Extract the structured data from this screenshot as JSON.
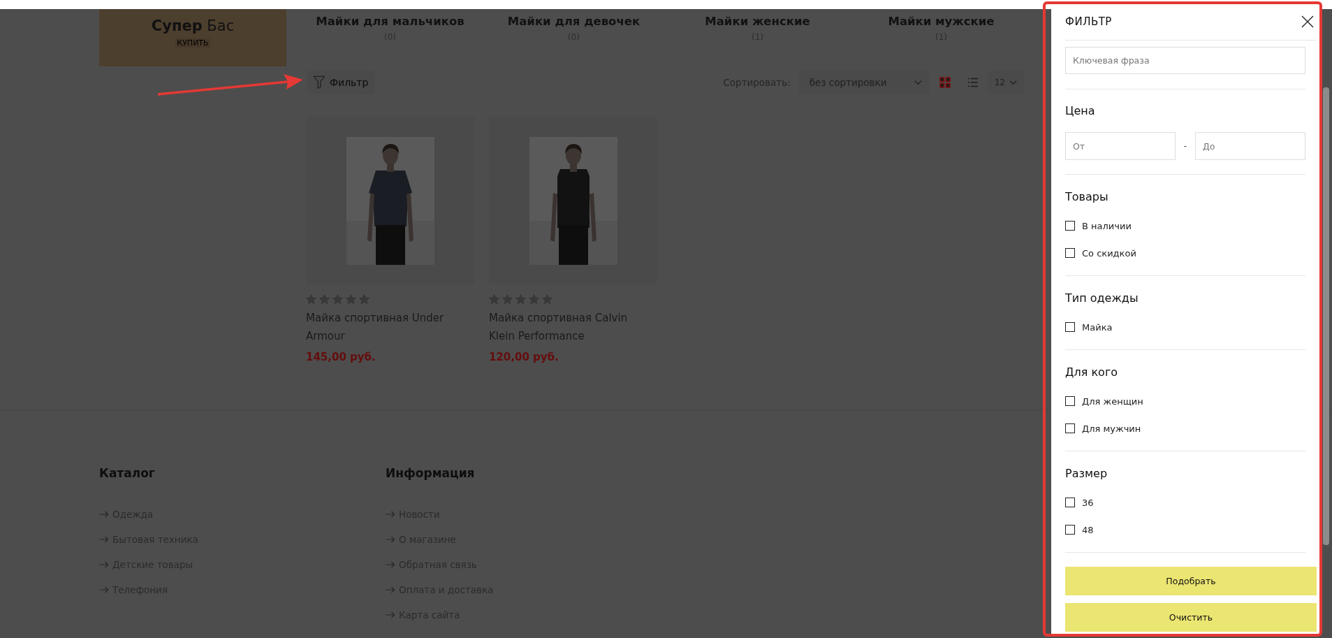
{
  "banner": {
    "title": "**Супер** Бас",
    "link": "КУПИТЬ"
  },
  "categories": [
    {
      "name": "Майки для мальчиков",
      "count": "(0)"
    },
    {
      "name": "Майки для девочек",
      "count": "(0)"
    },
    {
      "name": "Майки женские",
      "count": "(1)"
    },
    {
      "name": "Майки мужские",
      "count": "(1)"
    }
  ],
  "toolbar": {
    "filter_button": "Фильтр",
    "sort_label": "Сортировать:",
    "sort_value": "без сортировки",
    "views": [
      {
        "kind": "grid",
        "selected": true
      },
      {
        "kind": "list",
        "selected": false
      }
    ],
    "per_page": "12"
  },
  "products": [
    {
      "kind": "picture",
      "name": "Майка спортивная Under Armour",
      "price": "145,00 руб.",
      "stars": 0
    },
    {
      "kind": "picture",
      "name": "Майка спортивная Calvin Klein Performance",
      "price": "120,00 руб.",
      "stars": 0
    }
  ],
  "footer": {
    "columns": [
      {
        "title": "Каталог",
        "links": [
          "Одежда",
          "Бытовая техника",
          "Детские товары",
          "Телефония"
        ]
      },
      {
        "title": "Информация",
        "links": [
          "Новости",
          "О магазине",
          "Обратная связь",
          "Оплата и доставка",
          "Карта сайта"
        ]
      }
    ]
  },
  "filter_panel": {
    "title": "ФИЛЬТР",
    "sections": [
      {
        "kind": "search",
        "placeholder": "Ключевая фраза"
      },
      {
        "kind": "range",
        "title": "Цена",
        "from_placeholder": "От",
        "separator": "-",
        "to_placeholder": "До"
      },
      {
        "kind": "checks",
        "title": "Товары",
        "options": [
          {
            "label": "В наличии",
            "checked": false
          },
          {
            "label": "Со скидкой",
            "checked": false
          }
        ]
      },
      {
        "kind": "checks",
        "title": "Тип одежды",
        "options": [
          {
            "label": "Майка",
            "checked": false
          }
        ]
      },
      {
        "kind": "checks",
        "title": "Для кого",
        "options": [
          {
            "label": "Для женщин",
            "checked": false
          },
          {
            "label": "Для мужчин",
            "checked": false
          }
        ]
      },
      {
        "kind": "checks",
        "title": "Размер",
        "options": [
          {
            "label": "36",
            "checked": false
          },
          {
            "label": "48",
            "checked": false
          }
        ]
      }
    ],
    "buttons": [
      "Подобрать",
      "Очистить"
    ]
  }
}
